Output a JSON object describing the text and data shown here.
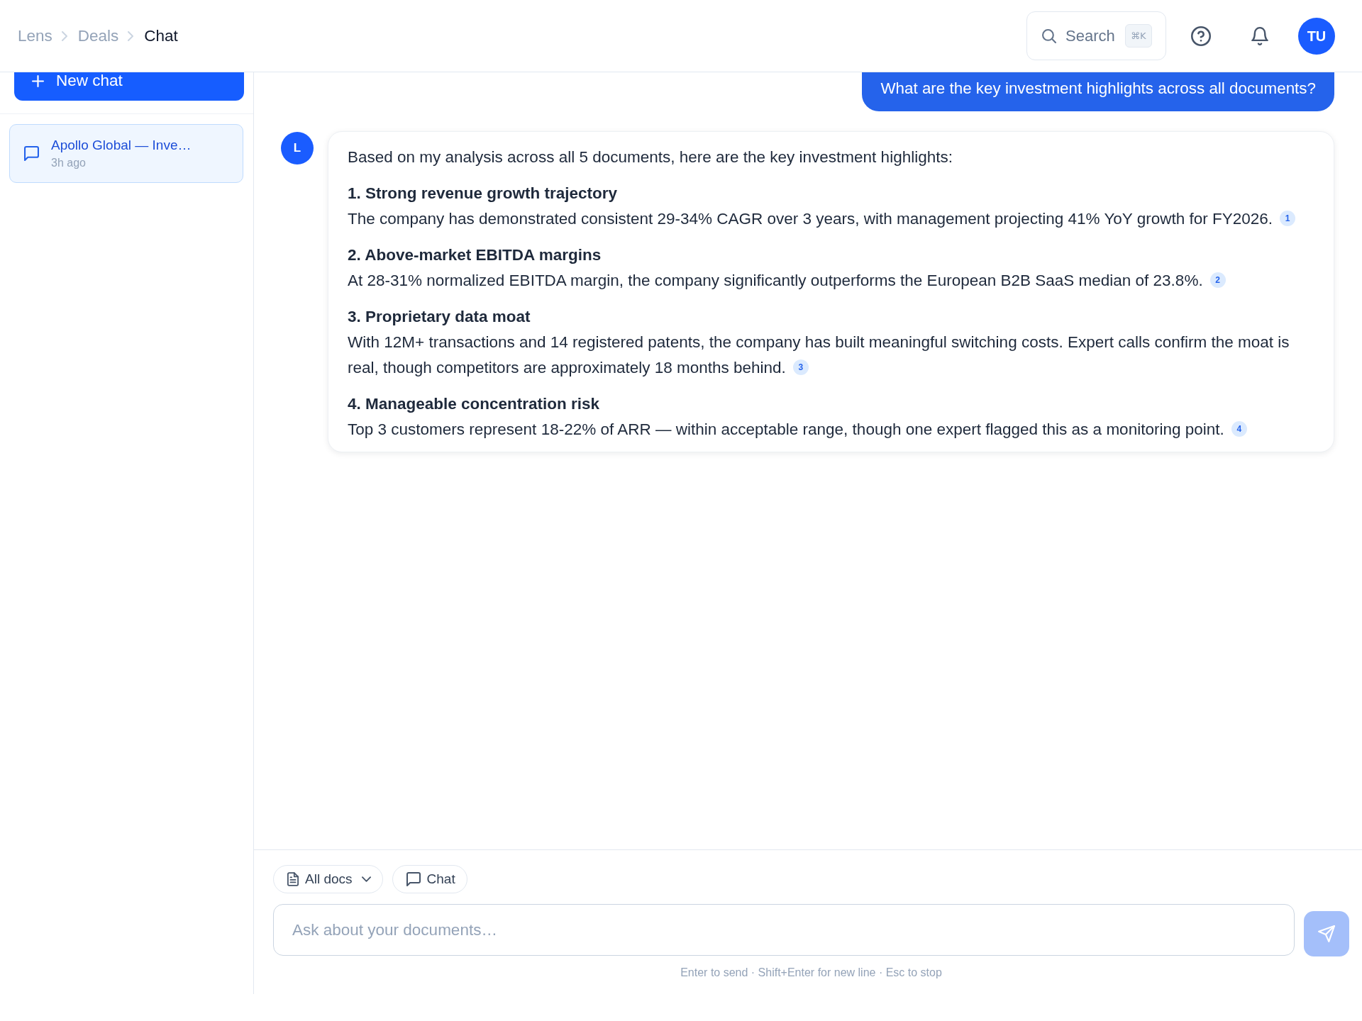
{
  "breadcrumb": [
    {
      "label": "Lens",
      "current": false
    },
    {
      "label": "Deals",
      "current": false
    },
    {
      "label": "Chat",
      "current": true
    }
  ],
  "header": {
    "search": {
      "label": "Search",
      "shortcut": "⌘K"
    },
    "user_initials": "TU"
  },
  "sidebar": {
    "new_chat_label": "New chat",
    "conversations": [
      {
        "title": "Apollo Global — Inve…",
        "time": "3h ago",
        "selected": true
      }
    ]
  },
  "messages": [
    {
      "kind": "user",
      "text": "What are the key investment highlights across all documents?"
    },
    {
      "kind": "assistant",
      "avatar": "L",
      "intro": "Based on my analysis across all 5 documents, here are the key investment highlights:",
      "sections": [
        {
          "heading": "1. Strong revenue growth trajectory",
          "body": "The company has demonstrated consistent 29-34% CAGR over 3 years, with management projecting 41% YoY growth for FY2026.",
          "citation": "1"
        },
        {
          "heading": "2. Above-market EBITDA margins",
          "body": "At 28-31% normalized EBITDA margin, the company significantly outperforms the European B2B SaaS median of 23.8%.",
          "citation": "2"
        },
        {
          "heading": "3. Proprietary data moat",
          "body": "With 12M+ transactions and 14 registered patents, the company has built meaningful switching costs. Expert calls confirm the moat is real, though competitors are approximately 18 months behind.",
          "citation": "3"
        },
        {
          "heading": "4. Manageable concentration risk",
          "body": "Top 3 customers represent 18-22% of ARR — within acceptable range, though one expert flagged this as a monitoring point.",
          "citation": "4"
        }
      ]
    }
  ],
  "composer": {
    "scope": {
      "label": "All docs"
    },
    "mode": {
      "label": "Chat"
    },
    "placeholder": "Ask about your documents…",
    "send_disabled": true,
    "hint": "Enter to send · Shift+Enter for new line · Esc to stop"
  }
}
